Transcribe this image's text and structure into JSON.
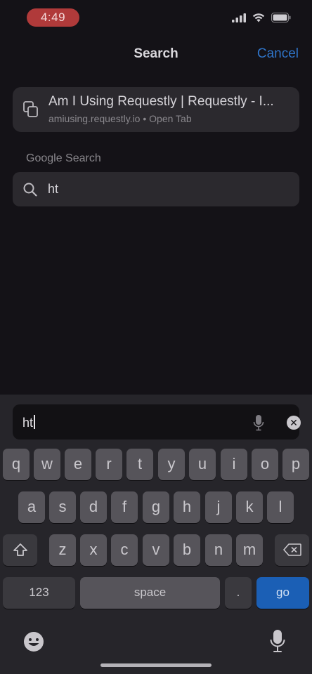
{
  "status_bar": {
    "time": "4:49"
  },
  "header": {
    "title": "Search",
    "cancel_label": "Cancel"
  },
  "suggestion": {
    "title": "Am I Using Requestly | Requestly - I...",
    "subtitle": "amiusing.requestly.io • Open Tab",
    "icon": "tabs-icon"
  },
  "google_section": {
    "label": "Google Search",
    "query": "ht",
    "icon": "search-icon"
  },
  "input": {
    "value": "ht"
  },
  "keyboard": {
    "row1": [
      "q",
      "w",
      "e",
      "r",
      "t",
      "y",
      "u",
      "i",
      "o",
      "p"
    ],
    "row2": [
      "a",
      "s",
      "d",
      "f",
      "g",
      "h",
      "j",
      "k",
      "l"
    ],
    "row3": [
      "z",
      "x",
      "c",
      "v",
      "b",
      "n",
      "m"
    ],
    "numbers_label": "123",
    "space_label": "space",
    "period_label": ".",
    "go_label": "go"
  },
  "colors": {
    "accent": "#2f74c8",
    "go_key": "#1b5fb5",
    "time_pill": "#b03a3a"
  }
}
